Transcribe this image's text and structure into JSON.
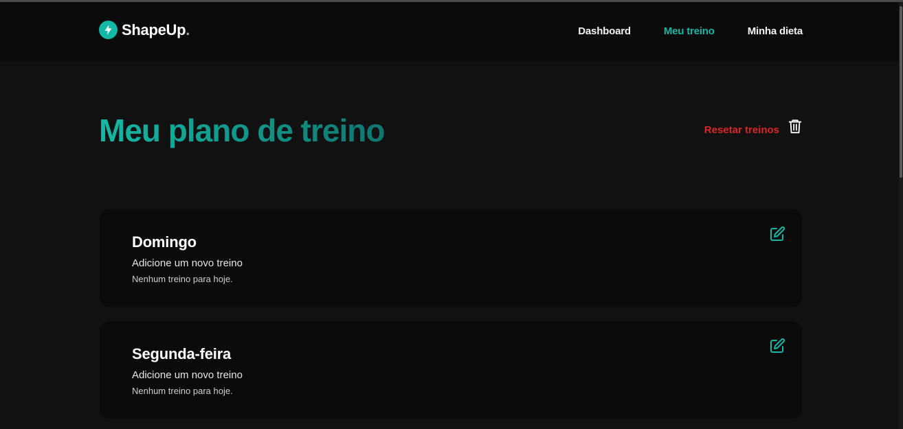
{
  "brand": {
    "name": "ShapeUp",
    "dot": ".",
    "accent": "#14b8a6"
  },
  "nav": {
    "items": [
      {
        "label": "Dashboard",
        "active": false
      },
      {
        "label": "Meu treino",
        "active": true
      },
      {
        "label": "Minha dieta",
        "active": false
      }
    ]
  },
  "page": {
    "title": "Meu plano de treino",
    "reset_label": "Resetar treinos"
  },
  "days": [
    {
      "day": "Domingo",
      "add_label": "Adicione um novo treino",
      "empty_label": "Nenhum treino para hoje."
    },
    {
      "day": "Segunda-feira",
      "add_label": "Adicione um novo treino",
      "empty_label": "Nenhum treino para hoje."
    }
  ],
  "icons": {
    "logo": "lightning-icon",
    "reset": "trash-icon",
    "edit": "edit-icon"
  },
  "colors": {
    "background": "#111111",
    "header": "#0b0b0b",
    "card": "#0b0b0b",
    "danger": "#dc2626"
  }
}
